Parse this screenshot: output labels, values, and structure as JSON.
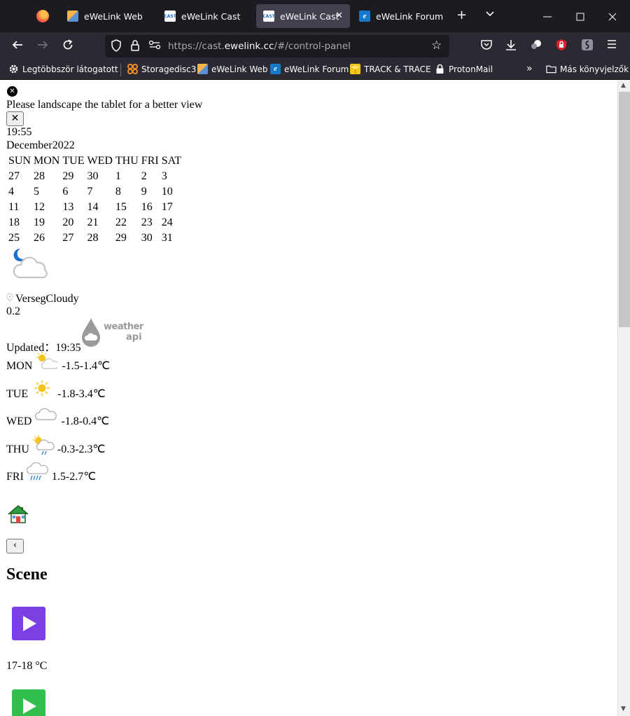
{
  "browser": {
    "tabs": [
      {
        "label": "eWeLink Web",
        "favicon": "ewelink-web-icon",
        "active": false
      },
      {
        "label": "eWeLink Cast",
        "favicon": "ewelink-cast-icon",
        "active": false
      },
      {
        "label": "eWeLink Cast",
        "favicon": "ewelink-cast-icon",
        "active": true
      },
      {
        "label": "eWeLink Forum",
        "favicon": "ewelink-forum-icon",
        "active": false
      }
    ],
    "url": {
      "prefix": "https://cast.",
      "host": "ewelink.cc",
      "path": "/#/control-panel"
    },
    "bookmarks": [
      {
        "label": "Legtöbbször látogatott",
        "icon": "gear-icon"
      },
      {
        "label": "Storagedisc3",
        "icon": "storage-icon"
      },
      {
        "label": "eWeLink Web",
        "icon": "ewelink-web-icon"
      },
      {
        "label": "eWeLink Forum",
        "icon": "ewelink-forum-icon"
      },
      {
        "label": "TRACK & TRACE",
        "icon": "package-icon"
      },
      {
        "label": "ProtonMail",
        "icon": "lock-icon"
      }
    ],
    "other_bookmarks": "Más könyvjelzők"
  },
  "page": {
    "notice": "Please landscape the tablet for a better view",
    "close_label": "✕",
    "clock": "19:55",
    "calendar": {
      "month": "December",
      "year": "2022",
      "weekdays": [
        "SUN",
        "MON",
        "TUE",
        "WED",
        "THU",
        "FRI",
        "SAT"
      ],
      "weeks": [
        [
          "27",
          "28",
          "29",
          "30",
          "1",
          "2",
          "3"
        ],
        [
          "4",
          "5",
          "6",
          "7",
          "8",
          "9",
          "10"
        ],
        [
          "11",
          "12",
          "13",
          "14",
          "15",
          "16",
          "17"
        ],
        [
          "18",
          "19",
          "20",
          "21",
          "22",
          "23",
          "24"
        ],
        [
          "25",
          "26",
          "27",
          "28",
          "29",
          "30",
          "31"
        ]
      ]
    },
    "weather": {
      "icon": "cloudy-night-icon",
      "location": "Verseg",
      "condition": "Cloudy",
      "value": "0.2",
      "updated_label": "Updated：",
      "updated_time": "19:35",
      "provider_line1": "weather",
      "provider_line2": "api"
    },
    "forecast": [
      {
        "day": "MON",
        "icon": "partly-cloudy-icon",
        "range": "-1.5-1.4℃"
      },
      {
        "day": "TUE",
        "icon": "sunny-icon",
        "range": "-1.8-3.4℃"
      },
      {
        "day": "WED",
        "icon": "cloud-icon",
        "range": "-1.8-0.4℃"
      },
      {
        "day": "THU",
        "icon": "sun-rain-icon",
        "range": "-0.3-2.3℃"
      },
      {
        "day": "FRI",
        "icon": "rain-icon",
        "range": "1.5-2.7℃"
      }
    ],
    "back_label": "‹",
    "scene_title": "Scene",
    "scenes": [
      {
        "color": "#7b3fe4",
        "label": "17-18 °C"
      },
      {
        "color": "#2fbf4a",
        "label": ""
      }
    ]
  }
}
